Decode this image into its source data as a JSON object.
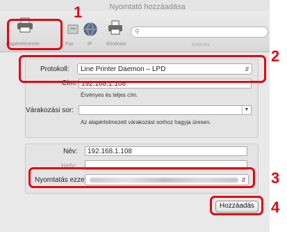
{
  "window": {
    "title": "Nyomtató hozzáadása"
  },
  "toolbar": {
    "items": [
      {
        "label": "Alapértelmezett"
      },
      {
        "label": "Fax"
      },
      {
        "label": "IP"
      },
      {
        "label": "Windows"
      }
    ],
    "search_label": "Keresés"
  },
  "protocol": {
    "label": "Protokoll:",
    "value": "Line Printer Daemon – LPD"
  },
  "address": {
    "label": "Cím:",
    "value": "192.168.1.108",
    "hint": "Érvényes és teljes cím."
  },
  "queue": {
    "label": "Várakozási sor:",
    "value": "",
    "hint": "Az alapértelmezett várakozási sorhoz hagyja üresen."
  },
  "name": {
    "label": "Név:",
    "value": "192.168.1.108"
  },
  "location": {
    "label": "Hely:",
    "value": ""
  },
  "print_using": {
    "label": "Nyomtatás ezzel:"
  },
  "add_button": {
    "label": "Hozzáadás"
  },
  "callouts": [
    "1",
    "2",
    "3",
    "4"
  ],
  "colors": {
    "callout": "#e30613",
    "window_bg": "#e9e9e9"
  }
}
